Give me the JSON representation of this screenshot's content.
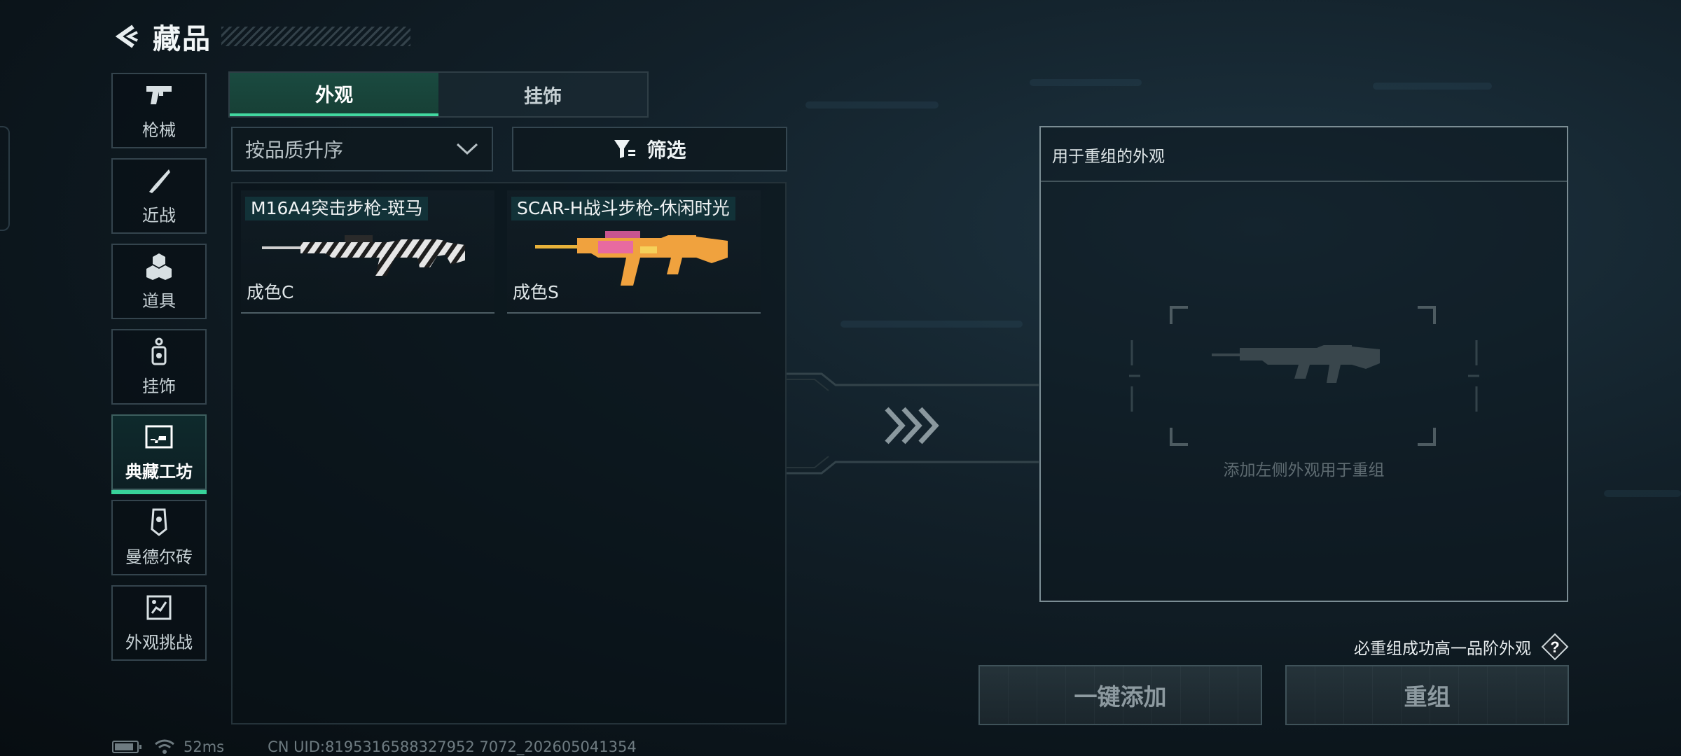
{
  "header": {
    "title": "藏品"
  },
  "sidebar": {
    "items": [
      {
        "label": "枪械",
        "icon": "pistol-icon"
      },
      {
        "label": "近战",
        "icon": "knife-icon"
      },
      {
        "label": "道具",
        "icon": "grenade-icon"
      },
      {
        "label": "挂饰",
        "icon": "charm-icon"
      },
      {
        "label": "典藏工坊",
        "icon": "workshop-icon",
        "active": true
      },
      {
        "label": "曼德尔砖",
        "icon": "mandel-brick-icon"
      },
      {
        "label": "外观挑战",
        "icon": "challenge-icon"
      }
    ]
  },
  "tabs": [
    {
      "label": "外观",
      "active": true
    },
    {
      "label": "挂饰",
      "active": false
    }
  ],
  "controls": {
    "sort_value": "按品质升序",
    "filter_label": "筛选"
  },
  "items": [
    {
      "name": "M16A4突击步枪-斑马",
      "grade": "成色C",
      "skin": "zebra"
    },
    {
      "name": "SCAR-H战斗步枪-休闲时光",
      "grade": "成色S",
      "skin": "orange-pink"
    }
  ],
  "recombine": {
    "title": "用于重组的外观",
    "placeholder_text": "添加左侧外观用于重组",
    "info_text": "必重组成功高一品阶外观",
    "help_label": "?",
    "add_button": "一键添加",
    "recombine_button": "重组"
  },
  "status": {
    "ping": "52ms",
    "uid": "CN UID:8195316588327952 7072_202605041354"
  },
  "colors": {
    "accent": "#38d39a",
    "tab_active": "#1a4a40",
    "name_tag": "#123238"
  }
}
